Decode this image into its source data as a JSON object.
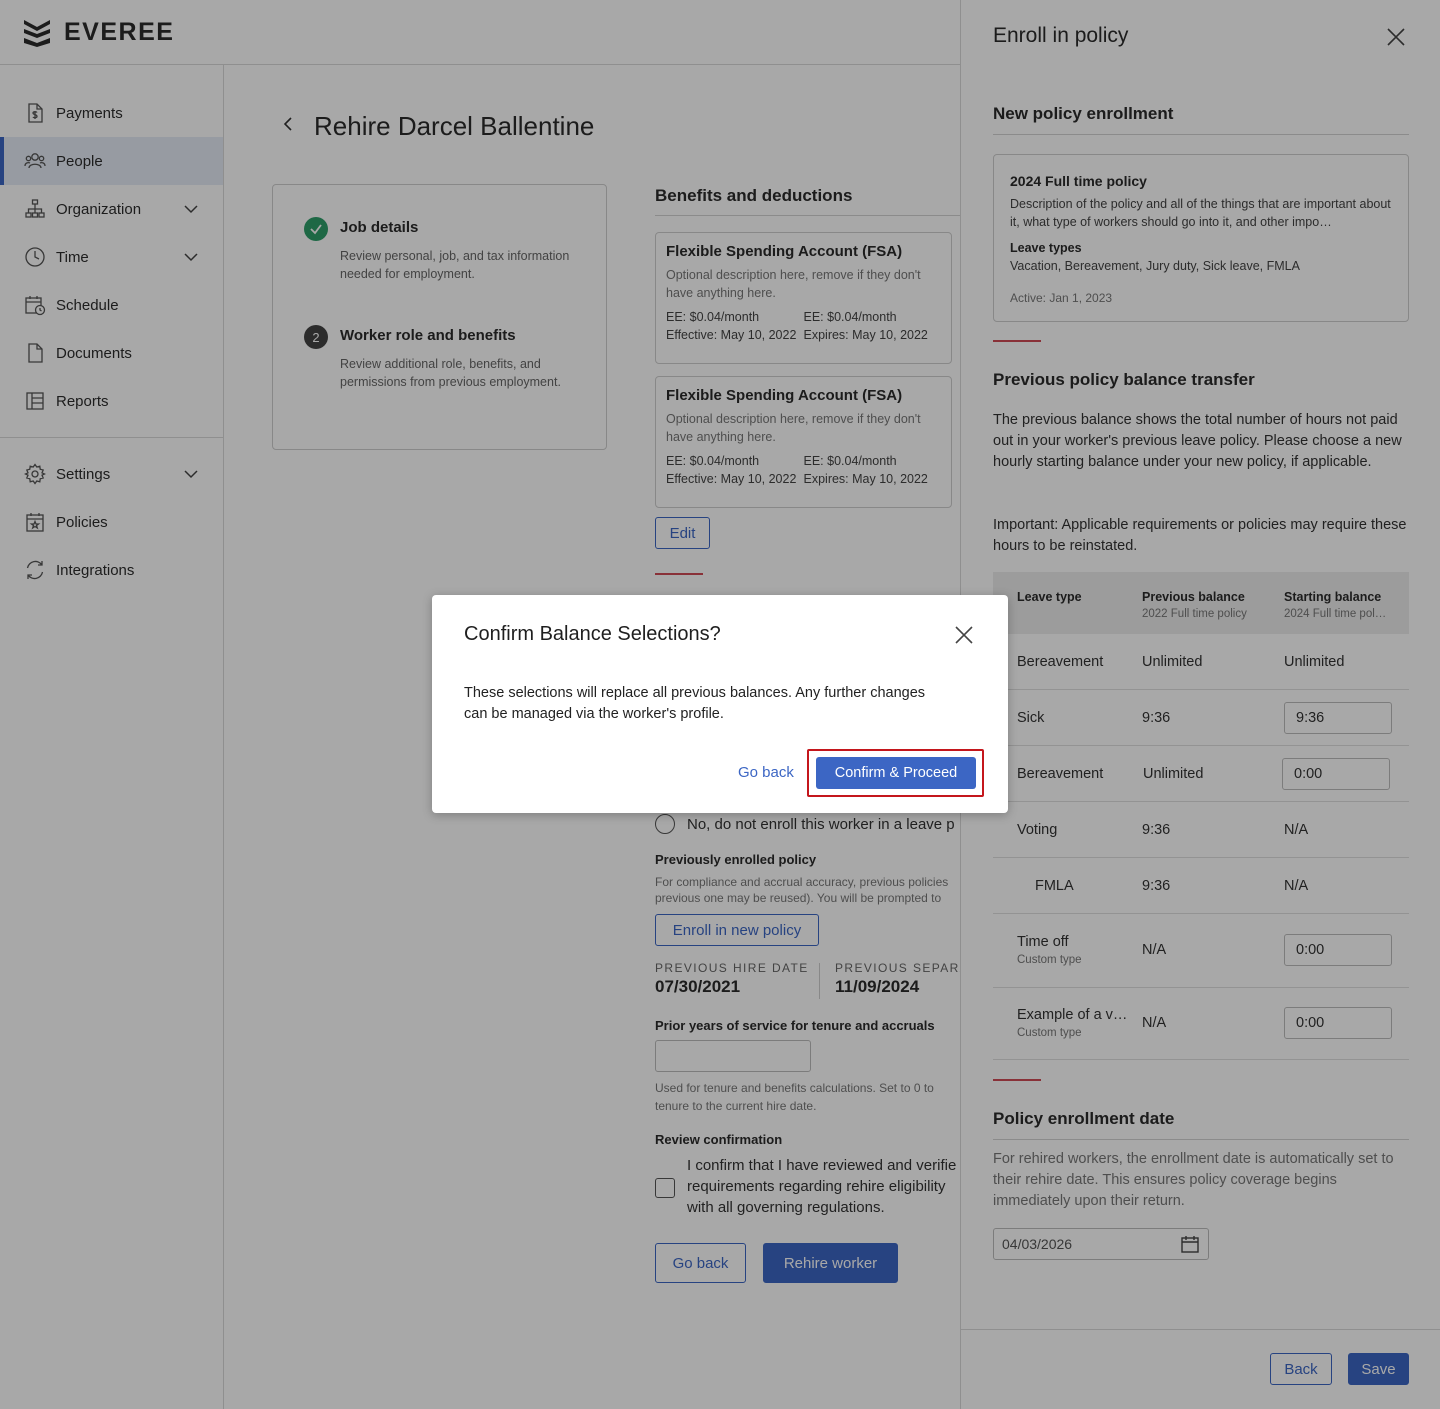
{
  "brand": {
    "name": "EVEREE"
  },
  "sidebar": {
    "items": [
      {
        "label": "Payments",
        "icon": "dollar-doc-icon"
      },
      {
        "label": "People",
        "icon": "people-icon",
        "active": true
      },
      {
        "label": "Organization",
        "icon": "org-chart-icon",
        "expandable": true
      },
      {
        "label": "Time",
        "icon": "clock-icon",
        "expandable": true
      },
      {
        "label": "Schedule",
        "icon": "calendar-clock-icon"
      },
      {
        "label": "Documents",
        "icon": "document-icon"
      },
      {
        "label": "Reports",
        "icon": "reports-icon"
      },
      {
        "label": "Settings",
        "icon": "gear-icon",
        "expandable": true
      },
      {
        "label": "Policies",
        "icon": "calendar-star-icon"
      },
      {
        "label": "Integrations",
        "icon": "sync-icon"
      }
    ]
  },
  "page": {
    "title": "Rehire Darcel Ballentine",
    "steps": [
      {
        "title": "Job details",
        "desc": "Review personal, job, and tax information needed for employment.",
        "status": "done"
      },
      {
        "number": "2",
        "title": "Worker role and benefits",
        "desc": "Review additional role, benefits, and permissions from previous employment."
      }
    ],
    "benefits": {
      "title": "Benefits and deductions",
      "cards": [
        {
          "title": "Flexible Spending Account (FSA)",
          "desc": "Optional description here, remove if they don't have anything here.",
          "ee1": "EE: $0.04/month",
          "ee2": "EE: $0.04/month",
          "effective": "Effective: May 10, 2022",
          "expires": "Expires: May 10, 2022"
        },
        {
          "title": "Flexible Spending Account (FSA)",
          "desc": "Optional description here, remove if they don't have anything here.",
          "ee1": "EE: $0.04/month",
          "ee2": "EE: $0.04/month",
          "effective": "Effective: May 10, 2022",
          "expires": "Expires: May 10, 2022"
        }
      ],
      "edit_label": "Edit"
    },
    "leave": {
      "no_enroll_label": "No, do not enroll this worker in a leave p",
      "prev_policy_label": "Previously enrolled policy",
      "prev_policy_help": "For compliance and accrual accuracy, previous policies",
      "prev_policy_help2": "previous one may be reused). You will be prompted to",
      "enroll_new_label": "Enroll in new policy"
    },
    "dates": {
      "hire_label": "PREVIOUS HIRE DATE",
      "hire_value": "07/30/2021",
      "sep_label": "PREVIOUS SEPARA",
      "sep_value": "11/09/2024"
    },
    "service": {
      "label": "Prior years of service for tenure and accruals",
      "help1": "Used for tenure and benefits calculations. Set to 0 to",
      "help2": "tenure to the current hire date."
    },
    "review": {
      "label": "Review confirmation",
      "line1": "I confirm that I have reviewed and verifie",
      "line2": "requirements regarding rehire eligibility",
      "line3": "with all governing regulations."
    },
    "buttons": {
      "go_back": "Go back",
      "rehire": "Rehire worker"
    }
  },
  "drawer": {
    "title": "Enroll in policy",
    "new_policy": {
      "title": "New policy enrollment",
      "card": {
        "name": "2024 Full time policy",
        "desc": "Description of the policy and all of the things that are important about it, what type of workers should go into it, and other impo…",
        "leave_types_label": "Leave types",
        "leave_types": "Vacation, Bereavement, Jury duty, Sick leave, FMLA",
        "active": "Active: Jan 1, 2023"
      }
    },
    "transfer": {
      "title": "Previous policy balance transfer",
      "para1": "The previous balance shows the total number of hours not paid out in your worker's previous leave policy. Please choose a new hourly starting balance under your new policy, if applicable.",
      "para2": "Important: Applicable requirements or policies may require these hours to be reinstated.",
      "columns": {
        "leave_type": "Leave type",
        "previous": "Previous balance",
        "previous_sub": "2022 Full time policy",
        "starting": "Starting balance",
        "starting_sub": "2024 Full time pol…"
      },
      "rows": [
        {
          "type": "Bereavement",
          "sub": "",
          "previous": "Unlimited",
          "starting": "Unlimited",
          "editable": false
        },
        {
          "type": "Sick",
          "sub": "",
          "previous": "9:36",
          "starting": "9:36",
          "editable": true
        },
        {
          "type": "Bereavement",
          "sub": "",
          "previous": "Unlimited",
          "starting": "0:00",
          "editable": true
        },
        {
          "type": "Voting",
          "sub": "",
          "previous": "9:36",
          "starting": "N/A",
          "editable": false
        },
        {
          "type": "FMLA",
          "sub": "",
          "previous": "9:36",
          "starting": "N/A",
          "editable": false
        },
        {
          "type": "Time off",
          "sub": "Custom type",
          "previous": "N/A",
          "starting": "0:00",
          "editable": true
        },
        {
          "type": "Example of a v…",
          "sub": "Custom type",
          "previous": "N/A",
          "starting": "0:00",
          "editable": true
        }
      ]
    },
    "enrollment_date": {
      "title": "Policy enrollment date",
      "para": "For rehired workers, the enrollment date is automatically set to their rehire date. This ensures policy coverage begins immediately upon their return.",
      "value": "04/03/2026"
    },
    "footer": {
      "back": "Back",
      "save": "Save"
    }
  },
  "modal": {
    "title": "Confirm Balance Selections?",
    "body": "These selections will replace all previous balances. Any further changes\n can be managed via the worker's profile.",
    "go_back": "Go back",
    "confirm": "Confirm & Proceed",
    "highlight_color": "#c4161c"
  },
  "colors": {
    "accent": "#3c66c4",
    "success": "#2e9e6a",
    "rule": "#d14b55"
  }
}
